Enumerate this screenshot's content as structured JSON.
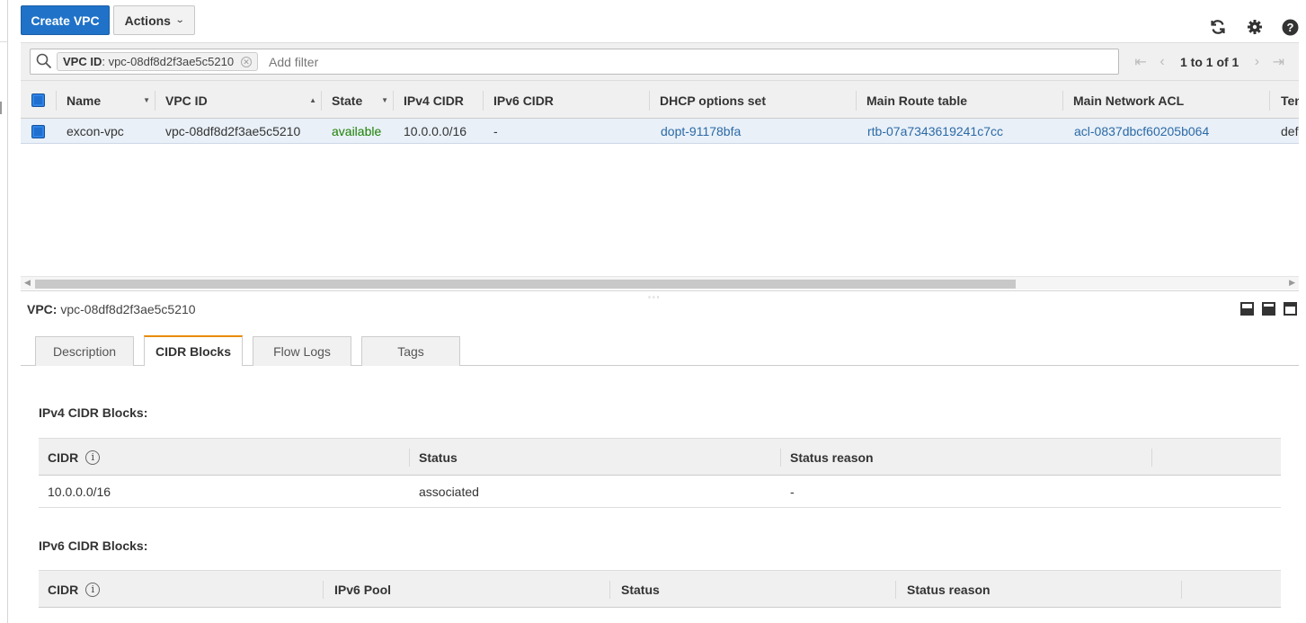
{
  "toolbar": {
    "create_label": "Create VPC",
    "actions_label": "Actions",
    "icons": [
      "refresh-icon",
      "gear-icon",
      "help-icon"
    ]
  },
  "filter": {
    "chip_key": "VPC ID",
    "chip_value": ": vpc-08df8d2f3ae5c5210",
    "placeholder": "Add filter",
    "pagination": "1 to 1 of 1"
  },
  "grid": {
    "columns": [
      "Name",
      "VPC ID",
      "State",
      "IPv4 CIDR",
      "IPv6 CIDR",
      "DHCP options set",
      "Main Route table",
      "Main Network ACL",
      "Ten"
    ],
    "rows": [
      {
        "name": "excon-vpc",
        "vpc_id": "vpc-08df8d2f3ae5c5210",
        "state": "available",
        "ipv4": "10.0.0.0/16",
        "ipv6": "-",
        "dhcp": "dopt-91178bfa",
        "route": "rtb-07a7343619241c7cc",
        "acl": "acl-0837dbcf60205b064",
        "tenancy": "defa"
      }
    ]
  },
  "detail": {
    "label": "VPC:",
    "vpc_id": "vpc-08df8d2f3ae5c5210",
    "tabs": [
      "Description",
      "CIDR Blocks",
      "Flow Logs",
      "Tags"
    ],
    "active_tab": "CIDR Blocks",
    "ipv4": {
      "title": "IPv4 CIDR Blocks:",
      "columns": [
        "CIDR",
        "Status",
        "Status reason"
      ],
      "rows": [
        {
          "cidr": "10.0.0.0/16",
          "status": "associated",
          "reason": "-"
        }
      ]
    },
    "ipv6": {
      "title": "IPv6 CIDR Blocks:",
      "columns": [
        "CIDR",
        "IPv6 Pool",
        "Status",
        "Status reason"
      ]
    }
  },
  "colors": {
    "primary": "#1f72c8",
    "available": "#1d8102",
    "link": "#2b6aa6",
    "tab_accent": "#e88b00"
  }
}
